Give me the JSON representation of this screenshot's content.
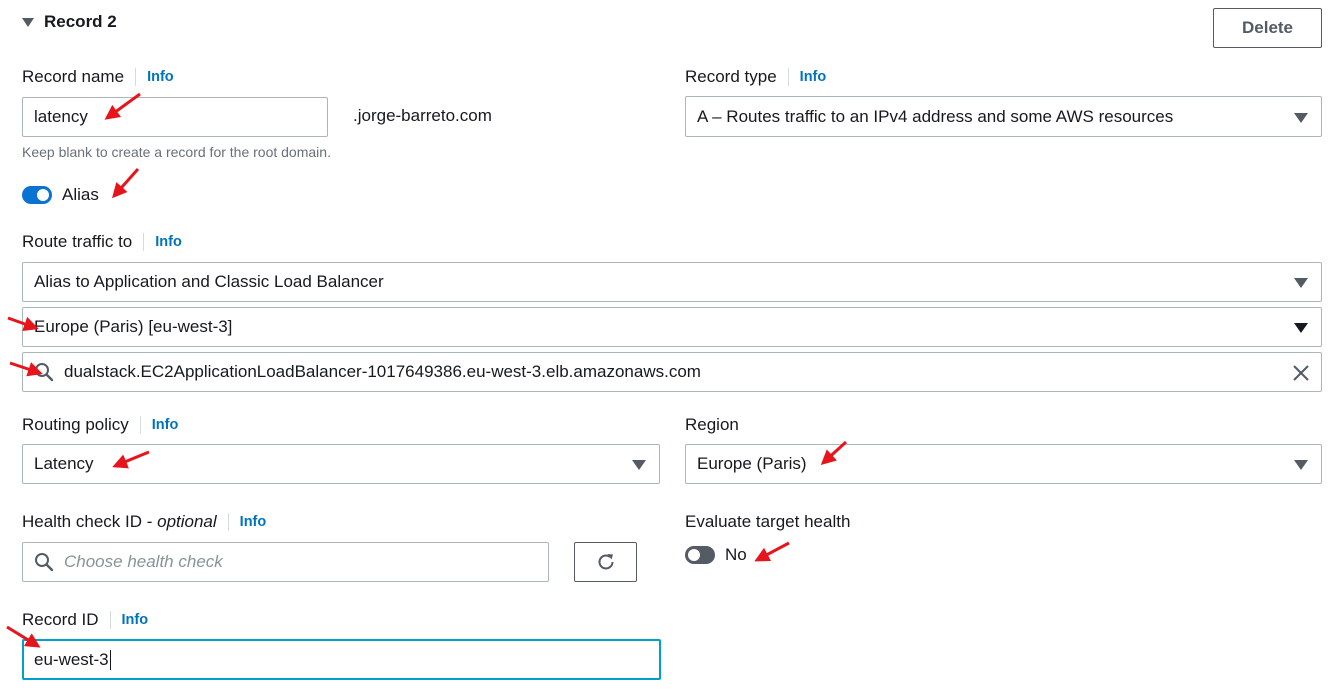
{
  "section": {
    "title": "Record 2",
    "delete_label": "Delete"
  },
  "info_label": "Info",
  "record_name": {
    "label": "Record name",
    "value": "latency",
    "suffix": ".jorge-barreto.com",
    "hint": "Keep blank to create a record for the root domain."
  },
  "record_type": {
    "label": "Record type",
    "value": "A – Routes traffic to an IPv4 address and some AWS resources"
  },
  "alias": {
    "label": "Alias",
    "enabled": true
  },
  "route_traffic": {
    "label": "Route traffic to",
    "endpoint": "Alias to Application and Classic Load Balancer",
    "region": "Europe (Paris) [eu-west-3]",
    "target": "dualstack.EC2ApplicationLoadBalancer-1017649386.eu-west-3.elb.amazonaws.com"
  },
  "routing_policy": {
    "label": "Routing policy",
    "value": "Latency"
  },
  "region": {
    "label": "Region",
    "value": "Europe (Paris)"
  },
  "health_check": {
    "label": "Health check ID - ",
    "label_optional": "optional",
    "placeholder": "Choose health check"
  },
  "evaluate_health": {
    "label": "Evaluate target health",
    "value_label": "No",
    "enabled": false
  },
  "record_id": {
    "label": "Record ID",
    "value": "eu-west-3"
  },
  "colors": {
    "accent": "#0073bb",
    "annotation_arrow": "#e8141b",
    "focus_border": "#00a1c9",
    "toggle_on": "#0972d3",
    "toggle_off": "#545b64"
  }
}
